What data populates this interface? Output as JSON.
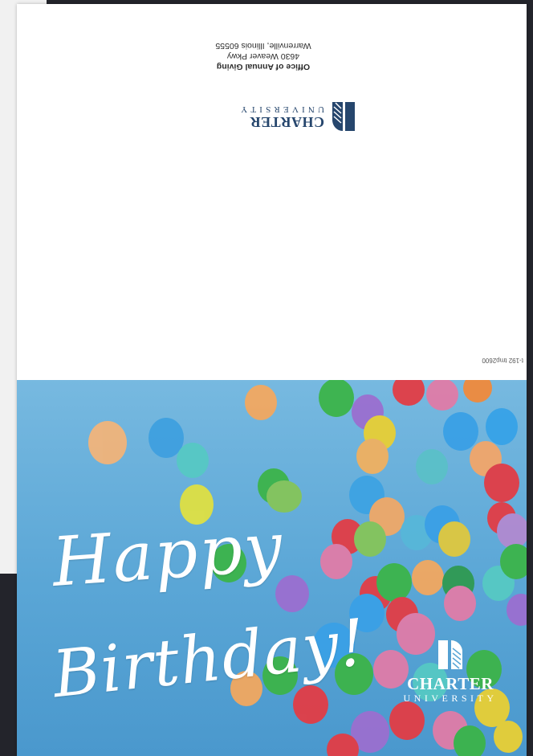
{
  "back": {
    "logo": {
      "word": "CHARTER",
      "sub": "UNIVERSITY",
      "color": "#26466d"
    },
    "address": {
      "office": "Office of Annual Giving",
      "street": "4630 Weaver Pkwy",
      "city": "Warrenville, Illinois 60555"
    },
    "code": "t-192 tmp2600"
  },
  "front": {
    "greeting_line1": "Happy",
    "greeting_line2": "Birthday!",
    "logo": {
      "word": "CHARTER",
      "sub": "UNIVERSITY"
    },
    "sky_color": "#5aa6d6"
  }
}
